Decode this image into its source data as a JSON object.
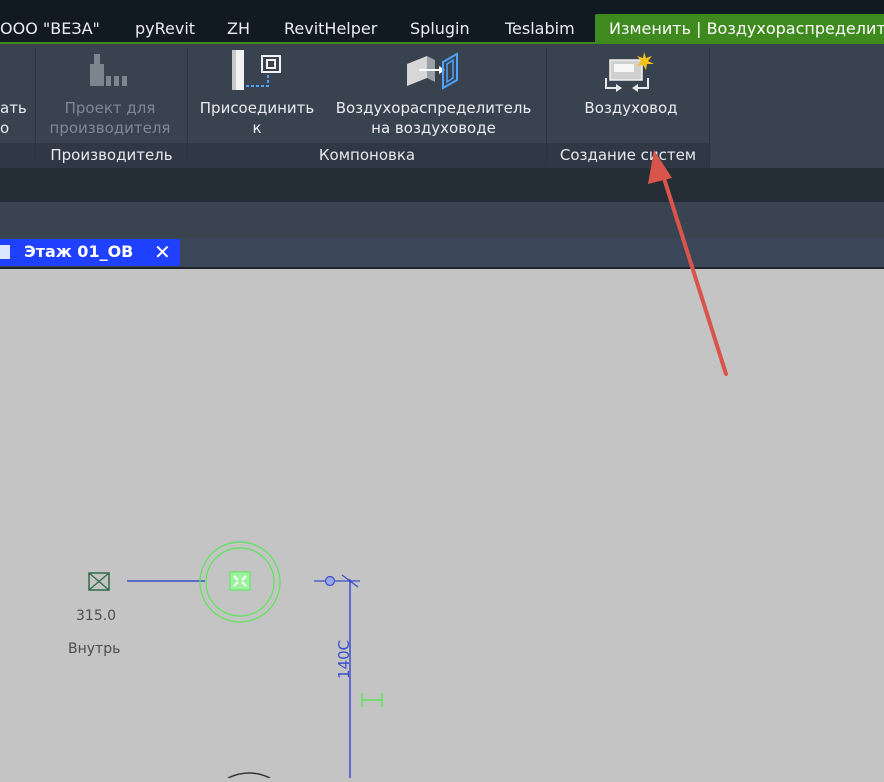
{
  "ribbon_tabs": [
    {
      "label": "ООО \"ВЕЗА\"",
      "active": false
    },
    {
      "label": "pyRevit",
      "active": false
    },
    {
      "label": "ZH",
      "active": false
    },
    {
      "label": "RevitHelper",
      "active": false
    },
    {
      "label": "Splugin",
      "active": false
    },
    {
      "label": "Teslabim",
      "active": false
    },
    {
      "label": "Изменить | Воздухораспределит",
      "active": true
    }
  ],
  "ribbon": {
    "partial_button": {
      "line1": "ать",
      "line2": "о"
    },
    "project_button": {
      "line1": "Проект для",
      "line2": "производителя",
      "disabled": true
    },
    "connect_button": {
      "line1": "Присоединить",
      "line2": "к"
    },
    "diffuser_button": {
      "line1": "Воздухораспределитель",
      "line2": "на воздуховоде"
    },
    "duct_button": {
      "line1": "Воздуховод"
    },
    "groups": {
      "manufacturer": "Производитель",
      "layout": "Компоновка",
      "systems": "Создание систем"
    }
  },
  "view_tab": {
    "label": "Этаж 01_ОВ",
    "close": "✕"
  },
  "drawing": {
    "terminal_size": "315.0",
    "terminal_location": "Внутрь",
    "duct_dimension": "140С"
  },
  "colors": {
    "active_tab": "#3f8a1f",
    "view_tab": "#2040ff",
    "annotation_arrow": "#d9544a",
    "selection": "#59e659",
    "duct_line": "#3a4fc8"
  },
  "icons": [
    "project-icon",
    "connect-icon",
    "diffuser-icon",
    "duct-icon",
    "document-icon",
    "close-icon"
  ]
}
